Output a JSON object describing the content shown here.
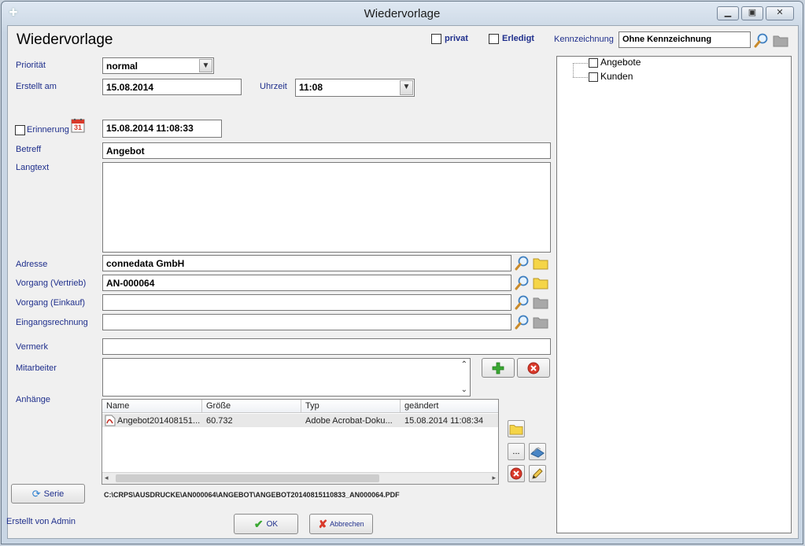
{
  "window": {
    "title": "Wiedervorlage"
  },
  "header": {
    "heading": "Wiedervorlage",
    "privat_label": "privat",
    "erledigt_label": "Erledigt",
    "kennzeichnung_label": "Kennzeichnung",
    "kennzeichnung_value": "Ohne Kennzeichnung"
  },
  "form": {
    "prioritaet_label": "Priorität",
    "prioritaet_value": "normal",
    "erstellt_am_label": "Erstellt am",
    "erstellt_am_value": "15.08.2014",
    "uhrzeit_label": "Uhrzeit",
    "uhrzeit_value": "11:08",
    "erinnerung_label": "Erinnerung",
    "erinnerung_calendar_day": "31",
    "erinnerung_value": "15.08.2014 11:08:33",
    "betreff_label": "Betreff",
    "betreff_value": "Angebot",
    "langtext_label": "Langtext",
    "langtext_value": "",
    "adresse_label": "Adresse",
    "adresse_value": "connedata GmbH",
    "vorgang_vertrieb_label": "Vorgang (Vertrieb)",
    "vorgang_vertrieb_value": "AN-000064",
    "vorgang_einkauf_label": "Vorgang (Einkauf)",
    "vorgang_einkauf_value": "",
    "eingangsrechnung_label": "Eingangsrechnung",
    "eingangsrechnung_value": "",
    "vermerk_label": "Vermerk",
    "vermerk_value": "",
    "mitarbeiter_label": "Mitarbeiter",
    "anhaenge_label": "Anhänge"
  },
  "attachments": {
    "columns": [
      "Name",
      "Größe",
      "Typ",
      "geändert"
    ],
    "rows": [
      {
        "name": "Angebot201408151...",
        "size": "60.732",
        "type": "Adobe Acrobat-Doku...",
        "changed": "15.08.2014 11:08:34"
      }
    ],
    "more_button_label": "...",
    "path": "C:\\CRPS\\AUSDRUCKE\\AN000064\\ANGEBOT\\ANGEBOT20140815110833_AN000064.PDF"
  },
  "footer": {
    "serie_label": "Serie",
    "erstellt_von": "Erstellt von Admin",
    "ok_label": "OK",
    "abbrechen_label": "Abbrechen"
  },
  "tree": {
    "items": [
      {
        "label": "Angebote"
      },
      {
        "label": "Kunden"
      }
    ]
  },
  "colors": {
    "label_blue": "#1f2f8c",
    "folder_yellow": "#f5d547",
    "cancel_red": "#d93a2b",
    "add_green": "#3aa832"
  }
}
